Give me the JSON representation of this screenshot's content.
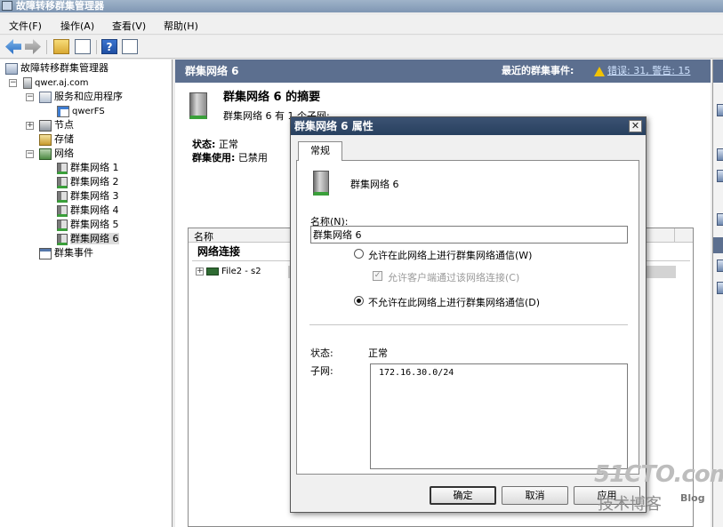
{
  "window": {
    "title": "故障转移群集管理器"
  },
  "menu": [
    "文件(F)",
    "操作(A)",
    "查看(V)",
    "帮助(H)"
  ],
  "toolbar": {
    "help_glyph": "?"
  },
  "tree": {
    "root": "故障转移群集管理器",
    "cluster": "qwer.aj.com",
    "services": "服务和应用程序",
    "service_item": "qwerFS",
    "nodes": "节点",
    "storage": "存储",
    "networks": "网络",
    "network_items": [
      "群集网络 1",
      "群集网络 2",
      "群集网络 3",
      "群集网络 4",
      "群集网络 5",
      "群集网络 6"
    ],
    "events": "群集事件"
  },
  "main": {
    "header_title": "群集网络 6",
    "recent_events_label": "最近的群集事件:",
    "recent_events_link": "错误: 31, 警告: 15",
    "summary_title": "群集网络 6 的摘要",
    "summary_sub": "群集网络 6 有 1 个子网:",
    "status_label": "状态:",
    "status_value": "正常",
    "cluster_use_label": "群集使用:",
    "cluster_use_value": "已禁用",
    "list_column": "名称",
    "group_title": "网络连接",
    "list_row": "File2 - s2"
  },
  "dialog": {
    "title": "群集网络 6 属性",
    "close_glyph": "✕",
    "tab_general": "常规",
    "network_name": "群集网络 6",
    "name_label": "名称(N):",
    "name_value": "群集网络 6",
    "option_allow": "允许在此网络上进行群集网络通信(W)",
    "option_allow_clients": "允许客户端通过该网络连接(C)",
    "option_deny": "不允许在此网络上进行群集网络通信(D)",
    "status_label": "状态:",
    "status_value": "正常",
    "subnet_label": "子网:",
    "subnet_value": "172.16.30.0/24",
    "ok": "确定",
    "cancel": "取消",
    "apply": "应用"
  },
  "watermark": {
    "site": "51CTO.com",
    "tagline": "技术博客",
    "blog": "Blog"
  }
}
